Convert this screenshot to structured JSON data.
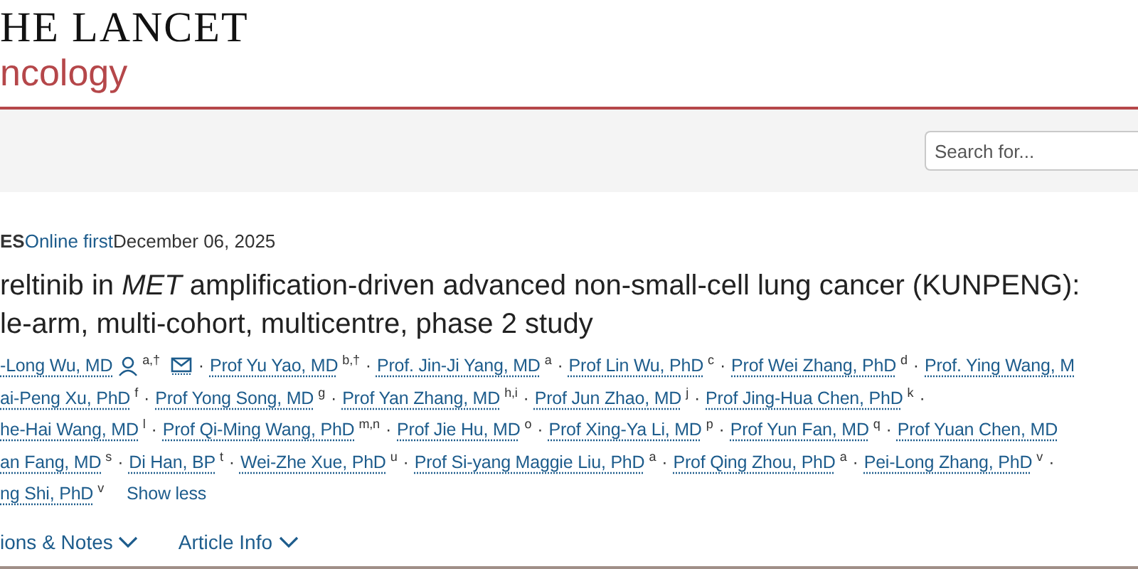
{
  "header": {
    "logo_top": "HE LANCET",
    "logo_bottom": "ncology"
  },
  "search": {
    "placeholder": "Search for..."
  },
  "meta": {
    "section": "ES",
    "status": "Online first",
    "date": "December 06, 2025"
  },
  "title": {
    "lines": [
      "reltinib in *MET* amplification-driven advanced non-small-cell lung cancer (KUNPENG):",
      "le-arm, multi-cohort, multicentre, phase 2 study"
    ]
  },
  "authors": [
    [
      {
        "kind": "author",
        "name": "-Long Wu, MD",
        "sup": "a,†",
        "corresponding": true,
        "email": true
      },
      {
        "kind": "separator",
        "text": "·"
      },
      {
        "kind": "author",
        "name": "Prof Yu Yao, MD",
        "sup": "b,†",
        "corresponding": false
      },
      {
        "kind": "separator",
        "text": "·"
      },
      {
        "kind": "author",
        "name": "Prof. Jin-Ji Yang, MD",
        "sup": "a",
        "corresponding": false
      },
      {
        "kind": "separator",
        "text": "·"
      },
      {
        "kind": "author",
        "name": "Prof Lin Wu, PhD",
        "sup": "c",
        "corresponding": false
      },
      {
        "kind": "separator",
        "text": "·"
      },
      {
        "kind": "author",
        "name": "Prof Wei Zhang, PhD",
        "sup": "d",
        "corresponding": false
      },
      {
        "kind": "separator",
        "text": "·"
      },
      {
        "kind": "author",
        "name": "Prof. Ying Wang, M",
        "corresponding": false
      }
    ],
    [
      {
        "kind": "author",
        "name": "ai-Peng Xu, PhD",
        "sup": "f",
        "corresponding": false
      },
      {
        "kind": "separator",
        "text": "·"
      },
      {
        "kind": "author",
        "name": "Prof Yong Song, MD",
        "sup": "g",
        "corresponding": false
      },
      {
        "kind": "separator",
        "text": "·"
      },
      {
        "kind": "author",
        "name": "Prof Yan Zhang, MD",
        "sup": "h,i",
        "corresponding": false
      },
      {
        "kind": "separator",
        "text": "·"
      },
      {
        "kind": "author",
        "name": "Prof Jun Zhao, MD",
        "sup": "j",
        "corresponding": false
      },
      {
        "kind": "separator",
        "text": "·"
      },
      {
        "kind": "author",
        "name": "Prof Jing-Hua Chen, PhD",
        "sup": "k",
        "corresponding": false
      },
      {
        "kind": "separator",
        "text": "·"
      }
    ],
    [
      {
        "kind": "author",
        "name": "he-Hai Wang, MD",
        "sup": "l",
        "corresponding": false
      },
      {
        "kind": "separator",
        "text": "·"
      },
      {
        "kind": "author",
        "name": "Prof Qi-Ming Wang, PhD",
        "sup": "m,n",
        "corresponding": false
      },
      {
        "kind": "separator",
        "text": "·"
      },
      {
        "kind": "author",
        "name": "Prof Jie Hu, MD",
        "sup": "o",
        "corresponding": false
      },
      {
        "kind": "separator",
        "text": "·"
      },
      {
        "kind": "author",
        "name": "Prof Xing-Ya Li, MD",
        "sup": "p",
        "corresponding": false
      },
      {
        "kind": "separator",
        "text": "·"
      },
      {
        "kind": "author",
        "name": "Prof Yun Fan, MD",
        "sup": "q",
        "corresponding": false
      },
      {
        "kind": "separator",
        "text": "·"
      },
      {
        "kind": "author",
        "name": "Prof Yuan Chen, MD",
        "corresponding": false
      }
    ],
    [
      {
        "kind": "author",
        "name": "an Fang, MD",
        "sup": "s",
        "corresponding": false
      },
      {
        "kind": "separator",
        "text": "·"
      },
      {
        "kind": "author",
        "name": "Di Han, BP",
        "sup": "t",
        "corresponding": false
      },
      {
        "kind": "separator",
        "text": "·"
      },
      {
        "kind": "author",
        "name": "Wei-Zhe Xue, PhD",
        "sup": "u",
        "corresponding": false
      },
      {
        "kind": "separator",
        "text": "·"
      },
      {
        "kind": "author",
        "name": "Prof Si-yang Maggie Liu, PhD",
        "sup": "a",
        "corresponding": false
      },
      {
        "kind": "separator",
        "text": "·"
      },
      {
        "kind": "author",
        "name": "Prof Qing Zhou, PhD",
        "sup": "a",
        "corresponding": false
      },
      {
        "kind": "separator",
        "text": "·"
      },
      {
        "kind": "author",
        "name": "Pei-Long Zhang, PhD",
        "sup": "v",
        "corresponding": false
      },
      {
        "kind": "separator",
        "text": "·"
      }
    ],
    [
      {
        "kind": "author",
        "name": "ng Shi, PhD",
        "sup": "v",
        "corresponding": false
      },
      {
        "kind": "toggle",
        "text": "Show less"
      }
    ]
  ],
  "sections": [
    {
      "label": "ions & Notes",
      "expanded": false
    },
    {
      "label": "Article Info",
      "expanded": false
    }
  ]
}
